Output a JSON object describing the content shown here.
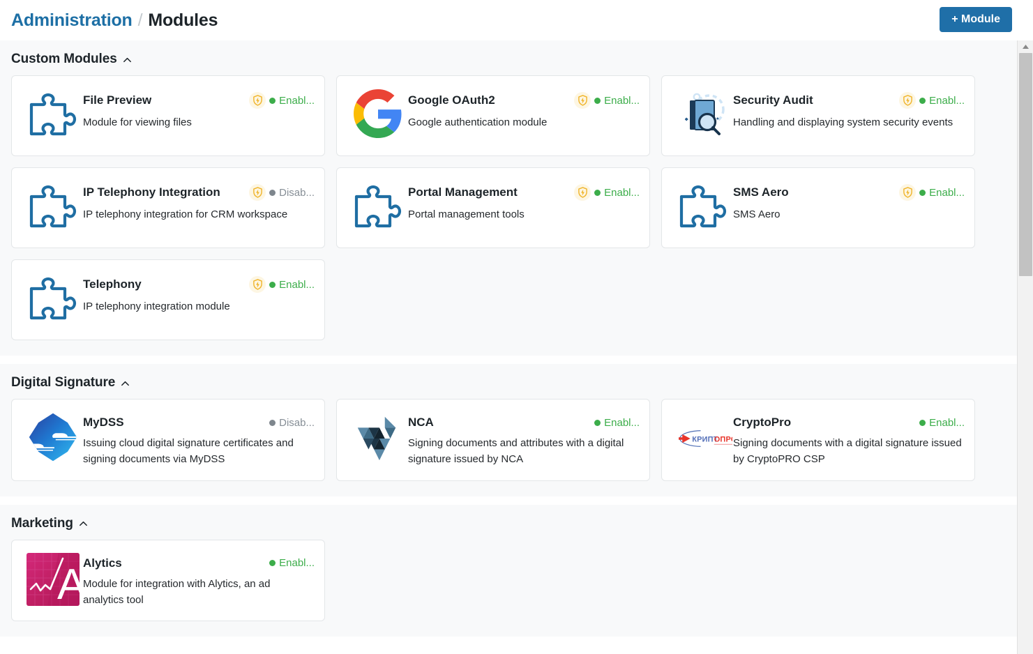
{
  "header": {
    "breadcrumb_root": "Administration",
    "breadcrumb_separator": "/",
    "breadcrumb_current": "Modules",
    "add_button_label": "+ Module"
  },
  "colors": {
    "accent": "#1f6fa8",
    "link": "#1d6fa5",
    "enabled": "#3cad4a",
    "disabled": "#868e96",
    "shield_bg": "#fdf6e3",
    "shield_stroke": "#f0b429",
    "section_bg": "#f8f9fa",
    "card_border": "#e3e6e8"
  },
  "status_labels": {
    "enabled": "Enabl...",
    "disabled": "Disab..."
  },
  "sections": [
    {
      "id": "custom-modules",
      "title": "Custom Modules",
      "collapse_icon": "chevron-up-icon",
      "expanded": true,
      "modules": [
        {
          "name": "File Preview",
          "description": "Module for viewing files",
          "status": "Enabl...",
          "status_state": "enabled",
          "has_shield": true,
          "icon": "puzzle-piece-icon"
        },
        {
          "name": "Google OAuth2",
          "description": "Google authentication module",
          "status": "Enabl...",
          "status_state": "enabled",
          "has_shield": true,
          "icon": "google-logo-icon"
        },
        {
          "name": "Security Audit",
          "description": "Handling and displaying system security events",
          "status": "Enabl...",
          "status_state": "enabled",
          "has_shield": true,
          "icon": "security-audit-icon"
        },
        {
          "name": "IP Telephony Integration",
          "description": "IP telephony integration for CRM workspace",
          "status": "Disab...",
          "status_state": "disabled",
          "has_shield": true,
          "icon": "puzzle-piece-icon"
        },
        {
          "name": "Portal Management",
          "description": "Portal management tools",
          "status": "Enabl...",
          "status_state": "enabled",
          "has_shield": true,
          "icon": "puzzle-piece-icon"
        },
        {
          "name": "SMS Aero",
          "description": "SMS Aero",
          "status": "Enabl...",
          "status_state": "enabled",
          "has_shield": true,
          "icon": "puzzle-piece-icon"
        },
        {
          "name": "Telephony",
          "description": "IP telephony integration module",
          "status": "Enabl...",
          "status_state": "enabled",
          "has_shield": true,
          "icon": "puzzle-piece-icon"
        }
      ]
    },
    {
      "id": "digital-signature",
      "title": "Digital Signature",
      "collapse_icon": "chevron-up-icon",
      "expanded": true,
      "modules": [
        {
          "name": "MyDSS",
          "description": "Issuing cloud digital signature certificates and signing documents via MyDSS",
          "status": "Disab...",
          "status_state": "disabled",
          "has_shield": false,
          "icon": "mydss-logo-icon"
        },
        {
          "name": "NCA",
          "description": "Signing documents and attributes with a digital signature issued by NCA",
          "status": "Enabl...",
          "status_state": "enabled",
          "has_shield": false,
          "icon": "nca-logo-icon"
        },
        {
          "name": "CryptoPro",
          "description": "Signing documents with a digital signature issued by CryptoPRO CSP",
          "status": "Enabl...",
          "status_state": "enabled",
          "has_shield": false,
          "icon": "cryptopro-logo-icon",
          "logo_text": "КРИПТОПРО"
        }
      ]
    },
    {
      "id": "marketing",
      "title": "Marketing",
      "collapse_icon": "chevron-up-icon",
      "expanded": true,
      "modules": [
        {
          "name": "Alytics",
          "description": "Module for integration with Alytics, an ad analytics tool",
          "status": "Enabl...",
          "status_state": "enabled",
          "has_shield": false,
          "icon": "alytics-logo-icon",
          "logo_letter": "A"
        }
      ]
    }
  ],
  "scrollbar": {
    "up_arrow": "triangle-up-icon",
    "thumb": "scroll-thumb"
  }
}
